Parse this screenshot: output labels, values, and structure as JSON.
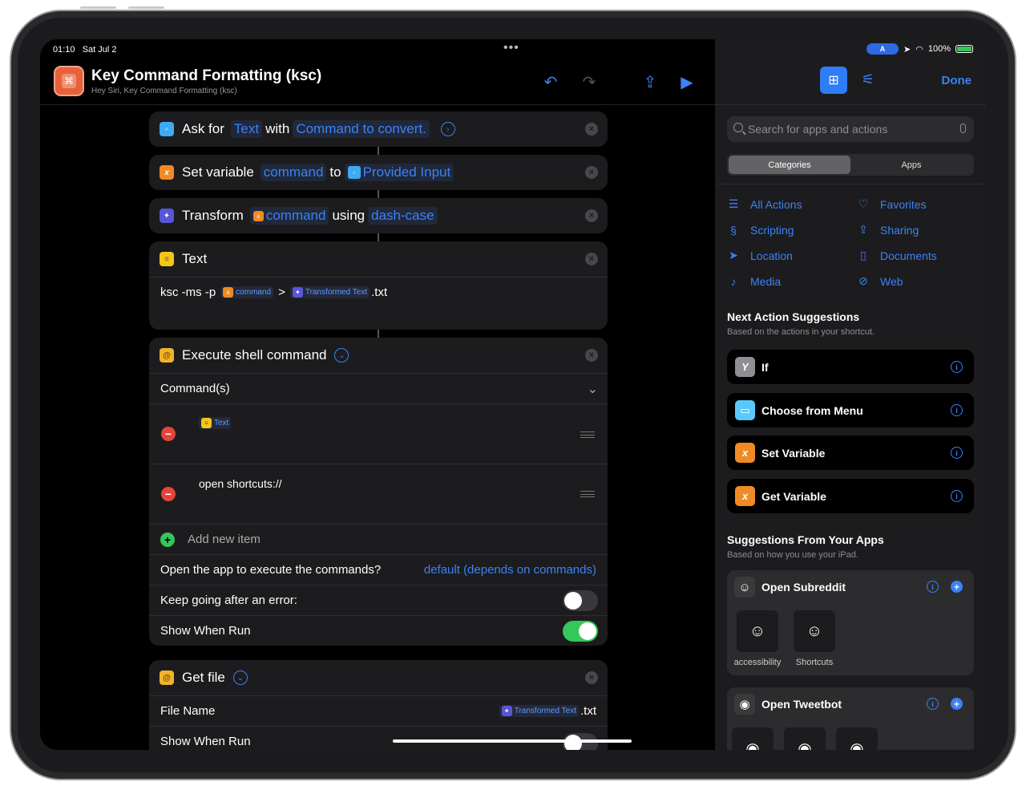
{
  "status": {
    "time": "01:10",
    "date": "Sat Jul 2",
    "battery": "100%"
  },
  "shortcut": {
    "title": "Key Command Formatting (ksc)",
    "subtitle": "Hey Siri, Key Command Formatting (ksc)"
  },
  "actions": {
    "ask": {
      "label": "Ask for",
      "token1": "Text",
      "with": "with",
      "token2": "Command to convert."
    },
    "setvar": {
      "label": "Set variable",
      "token1": "command",
      "to": "to",
      "token2": "Provided Input"
    },
    "transform": {
      "label": "Transform",
      "token1": "command",
      "using": "using",
      "token2": "dash-case"
    },
    "text": {
      "label": "Text",
      "prefix": "ksc -ms -p",
      "tok1": "command",
      "gt": ">",
      "tok2": "Transformed Text",
      "suffix": ".txt"
    },
    "shell": {
      "label": "Execute shell command",
      "commands_label": "Command(s)",
      "item1_token": "Text",
      "item2": "open shortcuts://",
      "add_item": "Add new item",
      "open_app_label": "Open the app to execute the commands?",
      "open_app_value": "default (depends on commands)",
      "keep_going": "Keep going after an error:",
      "show_when_run": "Show When Run"
    },
    "getfile": {
      "label": "Get file",
      "file_name": "File Name",
      "file_tok": "Transformed Text",
      "file_suffix": ".txt",
      "show_when_run": "Show When Run"
    }
  },
  "sidebar": {
    "done": "Done",
    "search_placeholder": "Search for apps and actions",
    "segments": [
      "Categories",
      "Apps"
    ],
    "categories": [
      {
        "label": "All Actions",
        "icon": "list-icon"
      },
      {
        "label": "Favorites",
        "icon": "heart-icon"
      },
      {
        "label": "Scripting",
        "icon": "scripting-icon"
      },
      {
        "label": "Sharing",
        "icon": "share-icon"
      },
      {
        "label": "Location",
        "icon": "location-icon"
      },
      {
        "label": "Documents",
        "icon": "document-icon"
      },
      {
        "label": "Media",
        "icon": "music-note-icon"
      },
      {
        "label": "Web",
        "icon": "compass-icon"
      }
    ],
    "next_title": "Next Action Suggestions",
    "next_sub": "Based on the actions in your shortcut.",
    "suggestions": [
      "If",
      "Choose from Menu",
      "Set Variable",
      "Get Variable"
    ],
    "apps_title": "Suggestions From Your Apps",
    "apps_sub": "Based on how you use your iPad.",
    "app1": {
      "title": "Open Subreddit",
      "tiles": [
        "accessibility",
        "Shortcuts"
      ]
    },
    "app2": {
      "title": "Open Tweetbot"
    }
  },
  "colors": {
    "accent": "#3b82f6",
    "orange": "#f08a24",
    "green": "#34c759",
    "red": "#e5443a"
  }
}
